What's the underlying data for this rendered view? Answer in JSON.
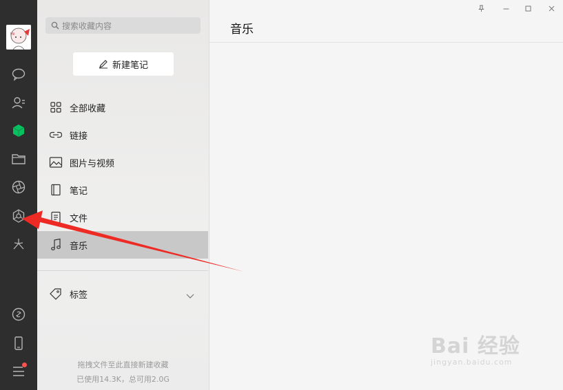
{
  "sidebar": {
    "icons": [
      "chat-icon",
      "contacts-icon",
      "favorites-icon",
      "files-icon",
      "moments-icon",
      "mini-programs-icon",
      "search-explore-icon",
      "link-icon",
      "phone-icon",
      "menu-icon"
    ],
    "active_icon": "favorites-icon",
    "accent_color": "#07c160",
    "badge_color": "#fa5151"
  },
  "panel": {
    "search_placeholder": "搜索收藏内容",
    "new_note_label": "新建笔记",
    "nav": [
      {
        "label": "全部收藏",
        "icon": "grid-icon"
      },
      {
        "label": "链接",
        "icon": "link-chain-icon"
      },
      {
        "label": "图片与视频",
        "icon": "image-icon"
      },
      {
        "label": "笔记",
        "icon": "notebook-icon"
      },
      {
        "label": "文件",
        "icon": "document-icon"
      },
      {
        "label": "音乐",
        "icon": "music-note-icon"
      }
    ],
    "active_nav": "音乐",
    "tags_label": "标签",
    "footer_hint": "拖拽文件至此直接新建收藏",
    "footer_storage": "已使用14.3K，总可用2.0G"
  },
  "main": {
    "title": "音乐"
  },
  "window_controls": [
    "pin-icon",
    "minimize-icon",
    "maximize-icon",
    "close-icon"
  ],
  "watermark": {
    "brand": "Bai 经验",
    "url": "jingyan.baidu.com"
  },
  "annotation": {
    "arrow_color": "#ee2a24"
  }
}
